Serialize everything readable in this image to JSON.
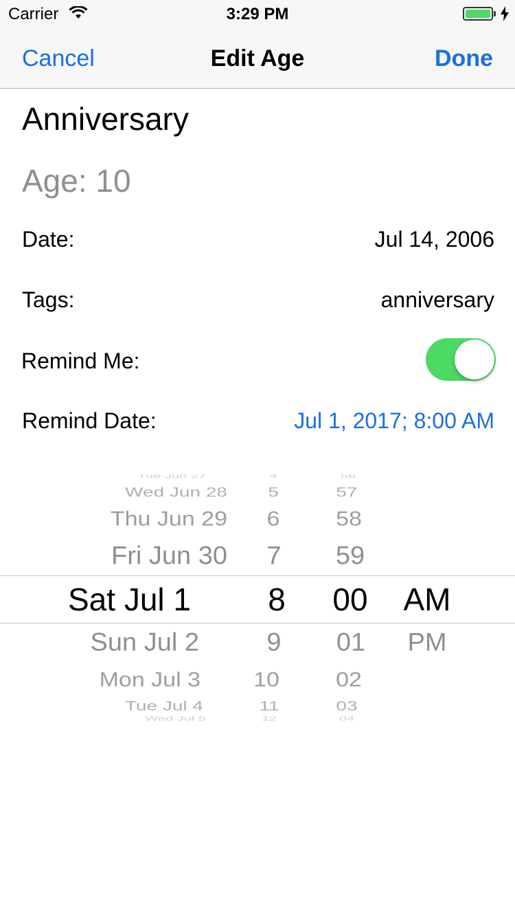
{
  "status_bar": {
    "carrier": "Carrier",
    "time": "3:29 PM"
  },
  "nav": {
    "cancel": "Cancel",
    "title": "Edit Age",
    "done": "Done"
  },
  "entry": {
    "name": "Anniversary",
    "age": "Age: 10",
    "date_label": "Date:",
    "date_value": "Jul 14, 2006",
    "tags_label": "Tags:",
    "tags_value": "anniversary",
    "remind_label": "Remind Me:",
    "remind_on": true,
    "remind_date_label": "Remind Date:",
    "remind_date_value": "Jul 1, 2017; 8:00 AM"
  },
  "picker": {
    "dates": [
      "Tue Jun 27",
      "Wed Jun 28",
      "Thu Jun 29",
      "Fri Jun 30",
      "Sat Jul 1",
      "Sun Jul 2",
      "Mon Jul 3",
      "Tue Jul 4",
      "Wed Jul 5"
    ],
    "hours": [
      "4",
      "5",
      "6",
      "7",
      "8",
      "9",
      "10",
      "11",
      "12"
    ],
    "minutes": [
      "56",
      "57",
      "58",
      "59",
      "00",
      "01",
      "02",
      "03",
      "04"
    ],
    "ampm": [
      "AM",
      "PM"
    ],
    "selected": {
      "date": "Sat Jul 1",
      "hour": "8",
      "minute": "00",
      "ampm": "AM"
    }
  },
  "colors": {
    "accent": "#1a6fdf",
    "toggle_on": "#4cd964",
    "secondary_text": "#8e8e93"
  }
}
